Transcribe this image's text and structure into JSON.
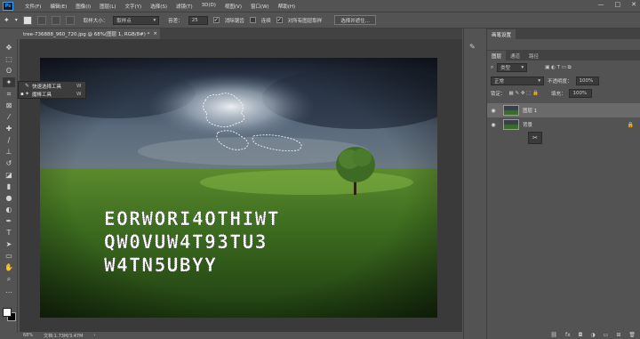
{
  "app": {
    "logo": "Ps"
  },
  "menu": [
    "文件(F)",
    "编辑(E)",
    "图像(I)",
    "图层(L)",
    "文字(Y)",
    "选择(S)",
    "滤镜(T)",
    "3D(D)",
    "视图(V)",
    "窗口(W)",
    "帮助(H)"
  ],
  "window_controls": [
    "—",
    "□",
    "✕"
  ],
  "options": {
    "tool_glyph": "✦",
    "sample_size_label": "取样大小：",
    "sample_size_value": "取样点",
    "tolerance_label": "容差：",
    "tolerance_value": "25",
    "antialias_label": "消除锯齿",
    "antialias_checked": true,
    "contiguous_label": "连续",
    "contiguous_checked": false,
    "all_layers_label": "对所有图层取样",
    "all_layers_checked": true,
    "select_mask_button": "选择并遮住..."
  },
  "document": {
    "tab_title": "tree-736888_960_720.jpg @ 68%(图层 1, RGB/8#) *",
    "tab_close": "×"
  },
  "flyout": {
    "items": [
      {
        "label": "快速选择工具",
        "key": "W",
        "active": false
      },
      {
        "label": "魔棒工具",
        "key": "W",
        "active": true
      }
    ]
  },
  "canvas_text": [
    "EORWORI4OTHIWT",
    "QW0VUW4T93TU3",
    "W4TN5UBYY"
  ],
  "status": {
    "zoom": "68%",
    "doc": "文档:1.73M/3.47M"
  },
  "panels": {
    "top_tabs": [
      "画笔设置"
    ],
    "layer_tabs": [
      "图层",
      "通道",
      "路径"
    ],
    "filter_kind": "类型",
    "blend_mode": "正常",
    "opacity_label": "不透明度：",
    "opacity_value": "100%",
    "lock_label": "锁定：",
    "fill_label": "填充：",
    "fill_value": "100%",
    "layers": [
      {
        "name": "图层 1",
        "selected": true,
        "locked": false
      },
      {
        "name": "背景",
        "selected": false,
        "locked": true
      }
    ]
  },
  "colors": {
    "foreground": "#ffffff",
    "background": "#000000",
    "accent": "#31a8ff"
  }
}
